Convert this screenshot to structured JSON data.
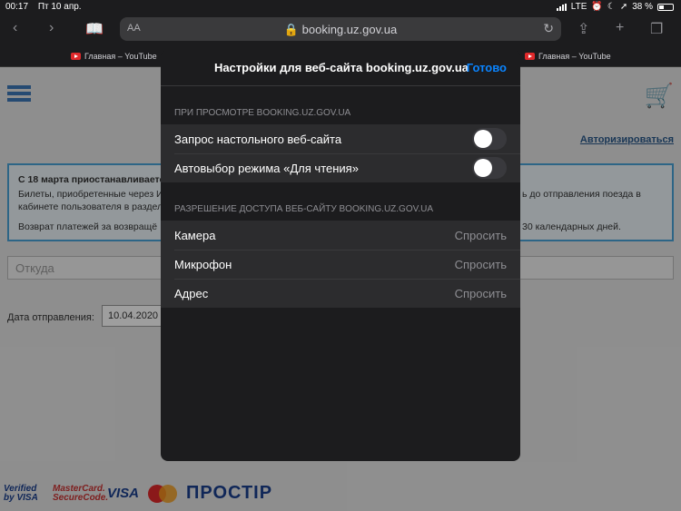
{
  "status_bar": {
    "time": "00:17",
    "date": "Пт 10 апр.",
    "network": "LTE",
    "battery": "38 %",
    "battery_level": 0.38
  },
  "browser": {
    "text_size_label": "AA",
    "url": "booking.uz.gov.ua"
  },
  "favorites": [
    {
      "label": "Главная – YouTube"
    },
    {
      "label": "Главная – YouTube"
    }
  ],
  "page": {
    "auth_link": "Авторизироваться",
    "notice": {
      "heading": "С 18 марта приостанавливается",
      "line1": "Билеты, приобретенные через И",
      "line2": "кабинете пользователя в раздел",
      "line3": "Возврат платежей за возвращё",
      "right1": "ь до отправления поезда в",
      "right2": "30 календарных дней."
    },
    "from_placeholder": "Откуда",
    "date_label": "Дата отправления:",
    "date_value": "10.04.2020",
    "payment_logos": {
      "verified_visa": "Verified by VISA",
      "mastercard": "MasterCard. SecureCode.",
      "visa": "VISA",
      "prostir": "ПРОСТІР"
    }
  },
  "modal": {
    "title": "Настройки для веб-сайта booking.uz.gov.ua",
    "done_label": "Готово",
    "section1": {
      "header": "ПРИ ПРОСМОТРЕ BOOKING.UZ.GOV.UA",
      "rows": [
        {
          "label": "Запрос настольного веб-сайта",
          "enabled": false
        },
        {
          "label": "Автовыбор режима «Для чтения»",
          "enabled": false
        }
      ]
    },
    "section2": {
      "header": "РАЗРЕШЕНИЕ ДОСТУПА ВЕБ-САЙТУ BOOKING.UZ.GOV.UA",
      "rows": [
        {
          "label": "Камера",
          "value": "Спросить"
        },
        {
          "label": "Микрофон",
          "value": "Спросить"
        },
        {
          "label": "Адрес",
          "value": "Спросить"
        }
      ]
    }
  },
  "colors": {
    "accent": "#0a84ff",
    "modal_bg": "#1c1c1e",
    "row_bg": "#2c2c2e",
    "brand_blue": "#3d78b8"
  }
}
